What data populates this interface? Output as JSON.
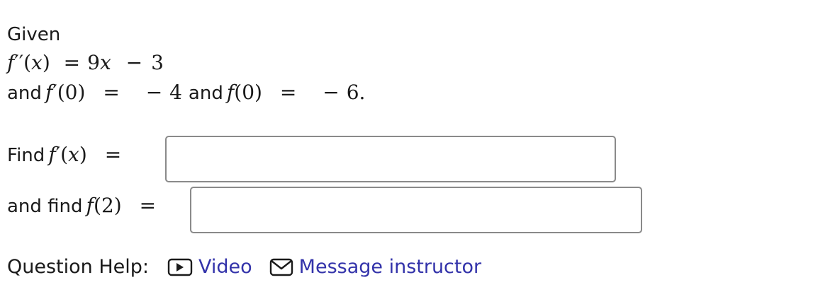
{
  "problem": {
    "given_label": "Given",
    "second_derivative": {
      "lhs_func": "f",
      "lhs_primes": "′′",
      "lhs_var": "(x)",
      "rhs_coef": "9",
      "rhs_var": "x",
      "rhs_const": "3"
    },
    "conditions": {
      "and_label": "and",
      "fprime0_func": "f",
      "fprime0_prime": "′",
      "fprime0_arg": "(0)",
      "fprime0_value": "4",
      "and_label_2": "and",
      "f0_func": "f",
      "f0_arg": "(0)",
      "f0_value": "6."
    }
  },
  "questions": {
    "find_fprime": {
      "label": "Find",
      "func": "f",
      "prime": "′",
      "arg": "(x)",
      "value": ""
    },
    "find_f2": {
      "label": "and find",
      "func": "f",
      "arg": "(2)",
      "value": ""
    }
  },
  "help": {
    "label": "Question Help:",
    "video_label": "Video",
    "video_icon": "video-play-icon",
    "message_label": "Message instructor",
    "message_icon": "envelope-icon",
    "link_color": "#3333aa"
  }
}
